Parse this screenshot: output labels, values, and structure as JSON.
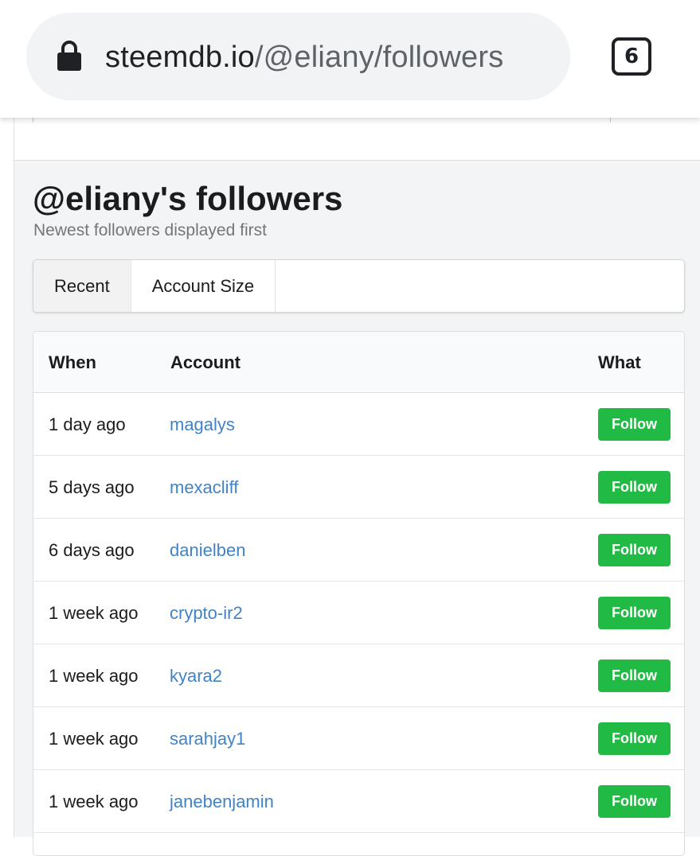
{
  "browser": {
    "url_host": "steemdb.io",
    "url_path": "/@eliany/followers",
    "tab_count": "6"
  },
  "header": {
    "title": "@eliany's followers",
    "subtitle": "Newest followers displayed first"
  },
  "menu": {
    "items": [
      {
        "label": "Recent",
        "active": true
      },
      {
        "label": "Account Size",
        "active": false
      }
    ]
  },
  "table": {
    "columns": [
      "When",
      "Account",
      "What"
    ],
    "rows": [
      {
        "when": "1 day ago",
        "account": "magalys",
        "what": "Follow"
      },
      {
        "when": "5 days ago",
        "account": "mexacliff",
        "what": "Follow"
      },
      {
        "when": "6 days ago",
        "account": "danielben",
        "what": "Follow"
      },
      {
        "when": "1 week ago",
        "account": "crypto-ir2",
        "what": "Follow"
      },
      {
        "when": "1 week ago",
        "account": "kyara2",
        "what": "Follow"
      },
      {
        "when": "1 week ago",
        "account": "sarahjay1",
        "what": "Follow"
      },
      {
        "when": "1 week ago",
        "account": "janebenjamin",
        "what": "Follow"
      }
    ]
  },
  "colors": {
    "follow_badge": "#21ba45",
    "link": "#4183c4"
  }
}
